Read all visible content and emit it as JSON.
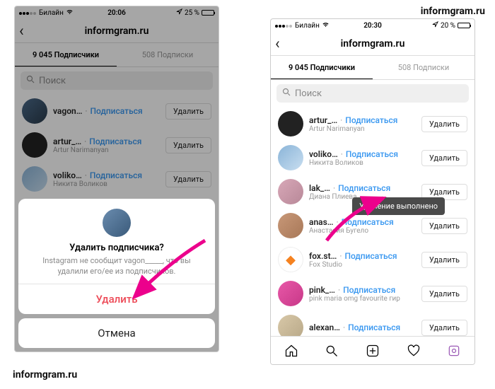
{
  "watermark": "informgram.ru",
  "left": {
    "status": {
      "carrier": "Билайн",
      "time": "20:06",
      "battery": "25 %"
    },
    "title": "informgram.ru",
    "tabs": {
      "followers": "9 045 Подписчики",
      "following": "508 Подписки"
    },
    "search_placeholder": "Поиск",
    "subscribe_label": "Подписаться",
    "remove_label": "Удалить",
    "users": [
      {
        "username": "vagon…",
        "display": ""
      },
      {
        "username": "artur_…",
        "display": "Artur Narimanyan"
      },
      {
        "username": "voliko…",
        "display": "Никита Воликов"
      }
    ],
    "sheet": {
      "title": "Удалить подписчика?",
      "message": "Instagram не сообщит vagon_____, что вы удалили его/ее из подписчиков.",
      "delete": "Удалить",
      "cancel": "Отмена"
    }
  },
  "right": {
    "status": {
      "carrier": "Билайн",
      "time": "20:30",
      "battery": "20 %"
    },
    "title": "informgram.ru",
    "tabs": {
      "followers": "9 045 Подписчики",
      "following": "508 Подписки"
    },
    "search_placeholder": "Поиск",
    "subscribe_label": "Подписаться",
    "remove_label": "Удалить",
    "toast": "Удаление выполнено",
    "users": [
      {
        "username": "artur_…",
        "display": "Artur Narimanyan"
      },
      {
        "username": "voliko…",
        "display": "Никита Воликов"
      },
      {
        "username": "lak_…",
        "display": "Диана Плиева"
      },
      {
        "username": "anas…",
        "display": "Анастасия Бугело"
      },
      {
        "username": "fox.st…",
        "display": "Fox Studio"
      },
      {
        "username": "pink_…",
        "display": "pink maria omg favourite гир"
      },
      {
        "username": "alexan…",
        "display": ""
      }
    ]
  }
}
